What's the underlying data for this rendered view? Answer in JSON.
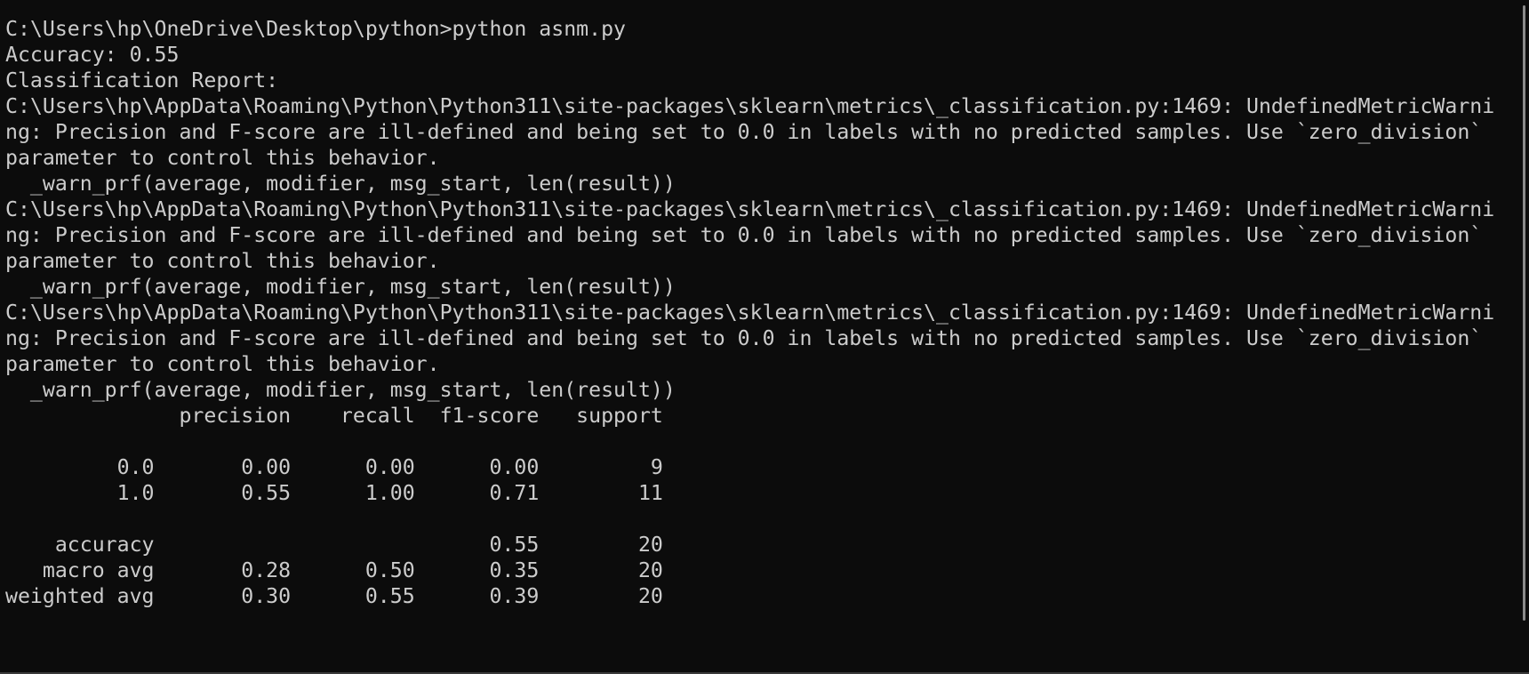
{
  "terminal": {
    "lines": [
      "C:\\Users\\hp\\OneDrive\\Desktop\\python>python asnm.py",
      "Accuracy: 0.55",
      "Classification Report:",
      "C:\\Users\\hp\\AppData\\Roaming\\Python\\Python311\\site-packages\\sklearn\\metrics\\_classification.py:1469: UndefinedMetricWarni",
      "ng: Precision and F-score are ill-defined and being set to 0.0 in labels with no predicted samples. Use `zero_division`",
      "parameter to control this behavior.",
      "  _warn_prf(average, modifier, msg_start, len(result))",
      "C:\\Users\\hp\\AppData\\Roaming\\Python\\Python311\\site-packages\\sklearn\\metrics\\_classification.py:1469: UndefinedMetricWarni",
      "ng: Precision and F-score are ill-defined and being set to 0.0 in labels with no predicted samples. Use `zero_division`",
      "parameter to control this behavior.",
      "  _warn_prf(average, modifier, msg_start, len(result))",
      "C:\\Users\\hp\\AppData\\Roaming\\Python\\Python311\\site-packages\\sklearn\\metrics\\_classification.py:1469: UndefinedMetricWarni",
      "ng: Precision and F-score are ill-defined and being set to 0.0 in labels with no predicted samples. Use `zero_division`",
      "parameter to control this behavior.",
      "  _warn_prf(average, modifier, msg_start, len(result))",
      "              precision    recall  f1-score   support",
      "",
      "         0.0       0.00      0.00      0.00         9",
      "         1.0       0.55      1.00      0.71        11",
      "",
      "    accuracy                           0.55        20",
      "   macro avg       0.28      0.50      0.35        20",
      "weighted avg       0.30      0.55      0.39        20"
    ]
  }
}
